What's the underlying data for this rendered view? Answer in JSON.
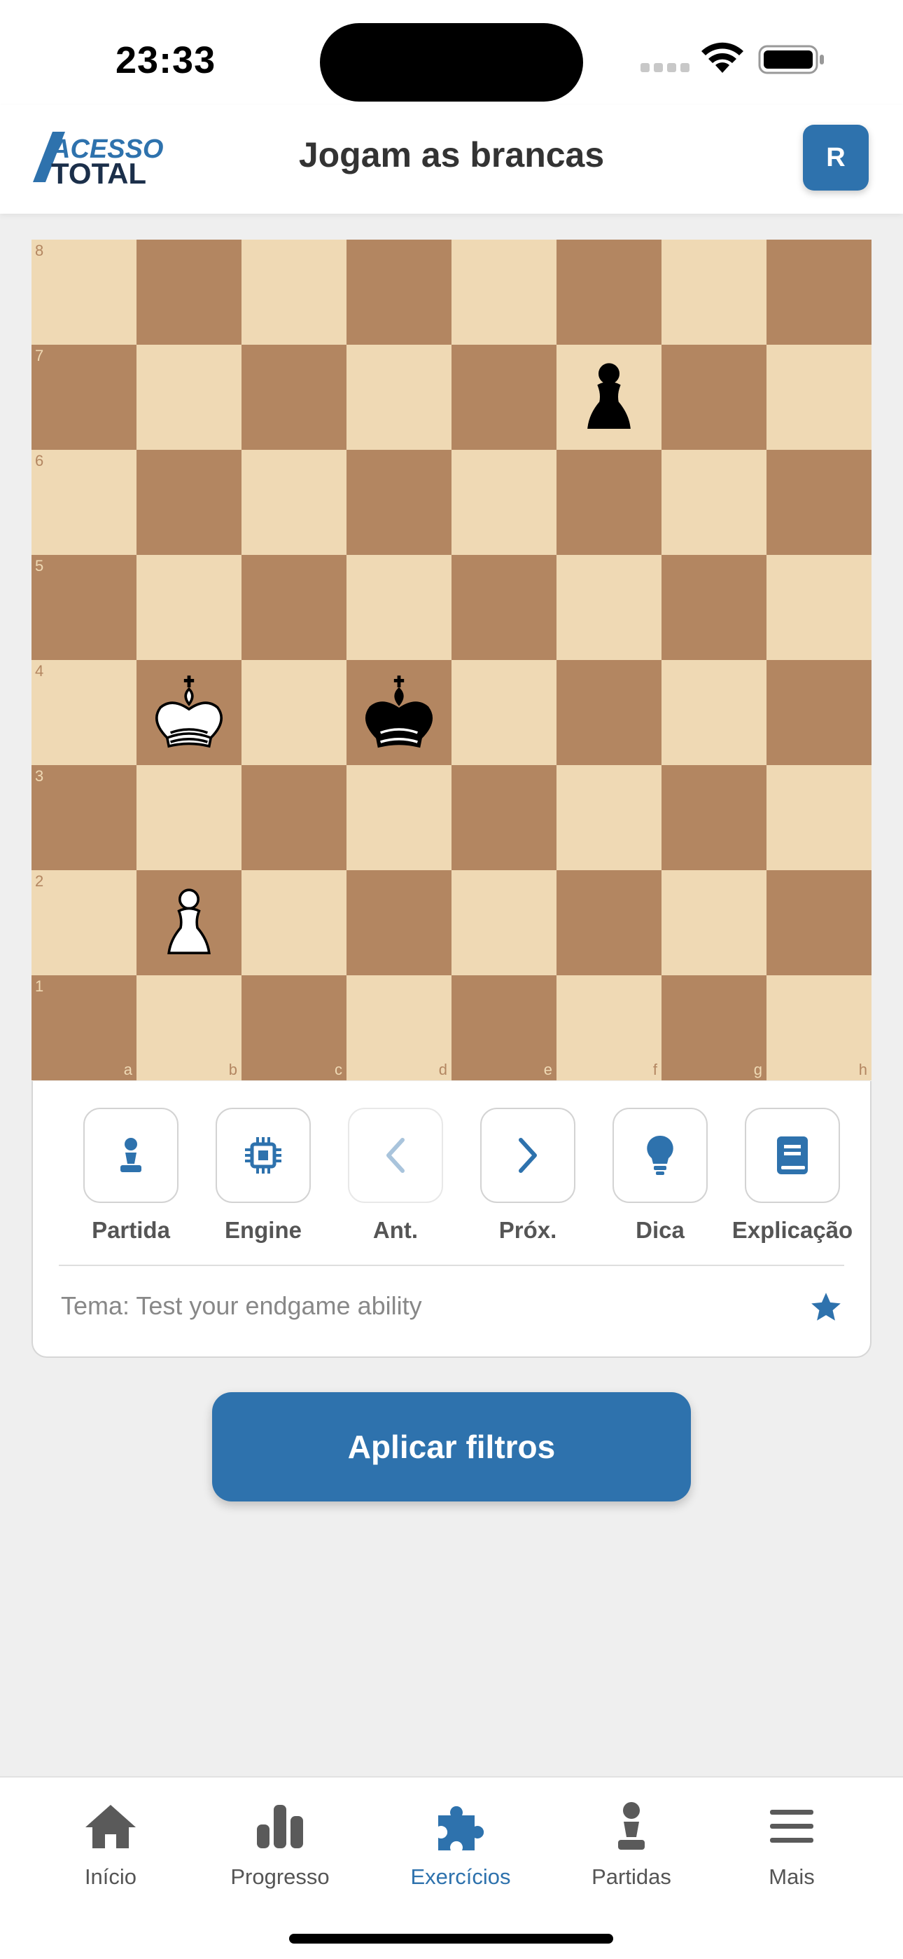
{
  "status_bar": {
    "time": "23:33"
  },
  "header": {
    "logo_text_top": "ACESSO",
    "logo_text_bottom": "TOTAL",
    "title": "Jogam as brancas",
    "avatar_initial": "R"
  },
  "board": {
    "files": [
      "a",
      "b",
      "c",
      "d",
      "e",
      "f",
      "g",
      "h"
    ],
    "ranks": [
      "8",
      "7",
      "6",
      "5",
      "4",
      "3",
      "2",
      "1"
    ],
    "pieces": [
      {
        "square": "f7",
        "color": "black",
        "type": "pawn"
      },
      {
        "square": "b4",
        "color": "white",
        "type": "king"
      },
      {
        "square": "d4",
        "color": "black",
        "type": "king"
      },
      {
        "square": "b2",
        "color": "white",
        "type": "pawn"
      }
    ]
  },
  "tools": [
    {
      "label": "Partida",
      "icon": "pawn-icon"
    },
    {
      "label": "Engine",
      "icon": "chip-icon"
    },
    {
      "label": "Ant.",
      "icon": "chevron-left-icon",
      "disabled": true
    },
    {
      "label": "Próx.",
      "icon": "chevron-right-icon"
    },
    {
      "label": "Dica",
      "icon": "lightbulb-icon"
    },
    {
      "label": "Explicação",
      "icon": "book-icon"
    }
  ],
  "theme_text": "Tema: Test your endgame ability",
  "apply_button": "Aplicar filtros",
  "bottom_nav": [
    {
      "label": "Início",
      "icon": "home-icon",
      "active": false
    },
    {
      "label": "Progresso",
      "icon": "bar-chart-icon",
      "active": false
    },
    {
      "label": "Exercícios",
      "icon": "puzzle-icon",
      "active": true
    },
    {
      "label": "Partidas",
      "icon": "pawn-icon",
      "active": false
    },
    {
      "label": "Mais",
      "icon": "menu-icon",
      "active": false
    }
  ],
  "colors": {
    "accent": "#2e72ad",
    "board_light": "#efd9b4",
    "board_dark": "#b38661"
  }
}
